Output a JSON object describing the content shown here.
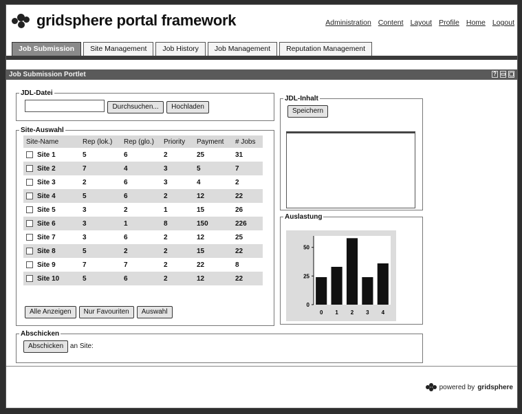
{
  "header": {
    "logo_text": "gridsphere portal framework",
    "nav": [
      "Administration",
      "Content",
      "Layout",
      "Profile",
      "Home",
      "Logout"
    ]
  },
  "tabs": [
    "Job Submission",
    "Site Management",
    "Job History",
    "Job Management",
    "Reputation Management"
  ],
  "portlet": {
    "title": "Job Submission Portlet",
    "controls": [
      "?",
      "▭",
      "▢"
    ]
  },
  "jdl_datei": {
    "legend": "JDL-Datei",
    "browse_label": "Durchsuchen...",
    "upload_label": "Hochladen"
  },
  "site_auswahl": {
    "legend": "Site-Auswahl",
    "columns": [
      "Site-Name",
      "Rep (lok.)",
      "Rep (glo.)",
      "Priority",
      "Payment",
      "# Jobs"
    ],
    "rows": [
      [
        "Site 1",
        "5",
        "6",
        "2",
        "25",
        "31"
      ],
      [
        "Site 2",
        "7",
        "4",
        "3",
        "5",
        "7"
      ],
      [
        "Site 3",
        "2",
        "6",
        "3",
        "4",
        "2"
      ],
      [
        "Site 4",
        "5",
        "6",
        "2",
        "12",
        "22"
      ],
      [
        "Site 5",
        "3",
        "2",
        "1",
        "15",
        "26"
      ],
      [
        "Site 6",
        "3",
        "1",
        "8",
        "150",
        "226"
      ],
      [
        "Site 7",
        "3",
        "6",
        "2",
        "12",
        "25"
      ],
      [
        "Site 8",
        "5",
        "2",
        "2",
        "15",
        "22"
      ],
      [
        "Site 9",
        "7",
        "7",
        "2",
        "22",
        "8"
      ],
      [
        "Site 10",
        "5",
        "6",
        "2",
        "12",
        "22"
      ]
    ],
    "buttons": [
      "Alle Anzeigen",
      "Nur Favouriten",
      "Auswahl"
    ]
  },
  "jdl_inhalt": {
    "legend": "JDL-Inhalt",
    "save_label": "Speichern"
  },
  "auslastung": {
    "legend": "Auslastung"
  },
  "chart_data": {
    "type": "bar",
    "categories": [
      "0",
      "1",
      "2",
      "3",
      "4"
    ],
    "values": [
      24,
      33,
      58,
      24,
      36
    ],
    "yticks": [
      "0",
      "25",
      "50"
    ],
    "ylim": [
      0,
      60
    ],
    "title": "",
    "xlabel": "",
    "ylabel": "",
    "bar_color": "#111111",
    "background": "#dcdcdc"
  },
  "abschicken": {
    "legend": "Abschicken",
    "button_label": "Abschicken",
    "site_label": "an Site:"
  },
  "footer": {
    "prefix": "powered by",
    "brand": "gridsphere"
  }
}
